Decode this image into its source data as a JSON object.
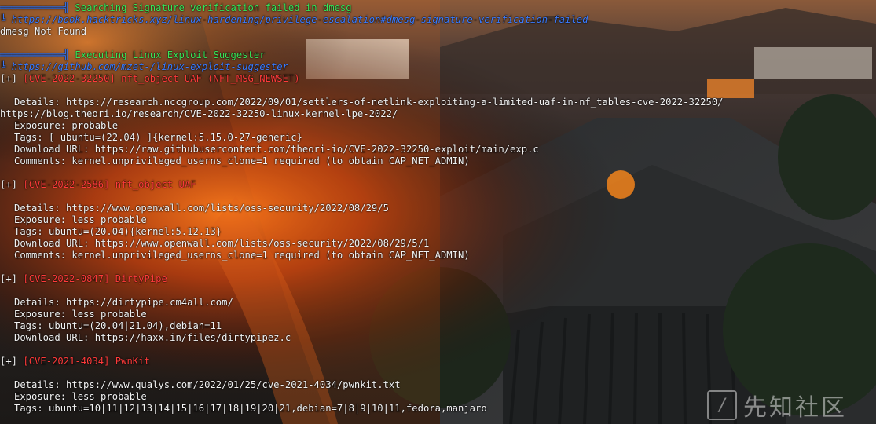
{
  "sections": {
    "dmesg": {
      "title": "Searching Signature verification failed in dmesg",
      "link": "https://book.hacktricks.xyz/linux-hardening/privilege-escalation#dmesg-signature-verification-failed",
      "result": "dmesg Not Found"
    },
    "suggester": {
      "title": "Executing Linux Exploit Suggester",
      "link": "https://github.com/mzet-/linux-exploit-suggester"
    }
  },
  "prefix": "[+]",
  "exploits": [
    {
      "cve": "[CVE-2022-32250]",
      "name": "nft_object UAF (NFT_MSG_NEWSET)",
      "details": "Details: https://research.nccgroup.com/2022/09/01/settlers-of-netlink-exploiting-a-limited-uaf-in-nf_tables-cve-2022-32250/",
      "details_wrap": "https://blog.theori.io/research/CVE-2022-32250-linux-kernel-lpe-2022/",
      "exposure": "Exposure: probable",
      "tags": "Tags: [ ubuntu=(22.04) ]{kernel:5.15.0-27-generic}",
      "download": "Download URL: https://raw.githubusercontent.com/theori-io/CVE-2022-32250-exploit/main/exp.c",
      "comments": "Comments: kernel.unprivileged_userns_clone=1 required (to obtain CAP_NET_ADMIN)"
    },
    {
      "cve": "[CVE-2022-2586]",
      "name": "nft_object UAF",
      "details": "Details: https://www.openwall.com/lists/oss-security/2022/08/29/5",
      "exposure": "Exposure: less probable",
      "tags": "Tags: ubuntu=(20.04){kernel:5.12.13}",
      "download": "Download URL: https://www.openwall.com/lists/oss-security/2022/08/29/5/1",
      "comments": "Comments: kernel.unprivileged_userns_clone=1 required (to obtain CAP_NET_ADMIN)"
    },
    {
      "cve": "[CVE-2022-0847]",
      "name": "DirtyPipe",
      "details": "Details: https://dirtypipe.cm4all.com/",
      "exposure": "Exposure: less probable",
      "tags": "Tags: ubuntu=(20.04|21.04),debian=11",
      "download": "Download URL: https://haxx.in/files/dirtypipez.c"
    },
    {
      "cve": "[CVE-2021-4034]",
      "name": "PwnKit",
      "details": "Details: https://www.qualys.com/2022/01/25/cve-2021-4034/pwnkit.txt",
      "exposure": "Exposure: less probable",
      "tags": "Tags: ubuntu=10|11|12|13|14|15|16|17|18|19|20|21,debian=7|8|9|10|11,fedora,manjaro"
    }
  ],
  "watermark": {
    "logo": "/",
    "text": "先知社区"
  },
  "colors": {
    "section": "#39e65a",
    "link": "#3b7cff",
    "cve": "#ff3b3b",
    "text": "#f2f2f2"
  }
}
